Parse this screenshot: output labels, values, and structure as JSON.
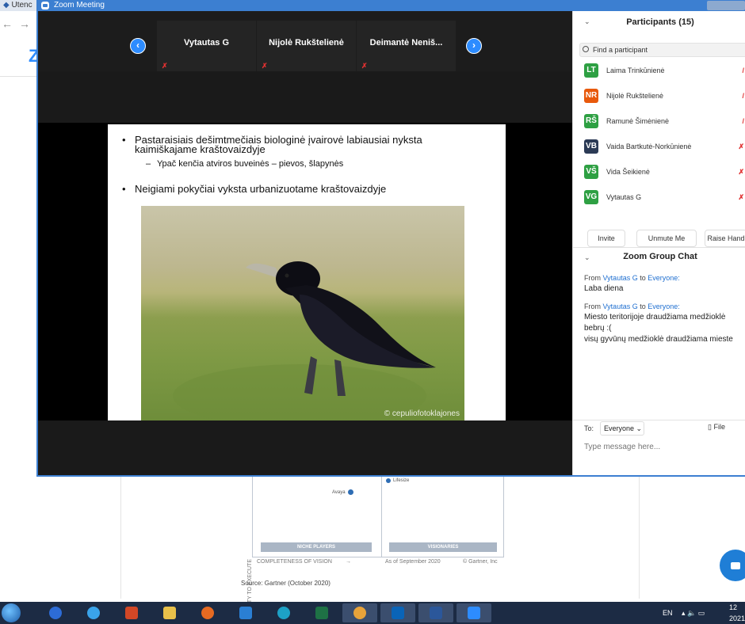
{
  "browser": {
    "tab_label": "Utenc",
    "back_symbol": "←",
    "forward_symbol": "→",
    "logo_letter": "Z"
  },
  "document": {
    "y_axis_label": "ABILITY TO EXECUTE",
    "x_axis_label": "COMPLETENESS OF VISION",
    "arrow": "→",
    "date_label": "As of September 2020",
    "copyright": "© Gartner, Inc",
    "quadrant_left": "NICHE PLAYERS",
    "quadrant_right": "VISIONARIES",
    "vendor_1": "Avaya",
    "vendor_2": "Lifesize",
    "source": "Source: Gartner (October 2020)"
  },
  "zoom": {
    "window_title": "Zoom Meeting",
    "prev_arrow": "‹",
    "next_arrow": "›",
    "thumbnails": [
      {
        "name": "Vytautas G"
      },
      {
        "name": "Nijolė Rukštelienė"
      },
      {
        "name": "Deimantė  Neniš..."
      }
    ],
    "slide": {
      "bullet1": "Pastaraisiais dešimtmečiais biologinė įvairovė labiausiai nyksta kaimiškajame kraštovaizdyje",
      "sub1": "Ypač kenčia atviros buveinės – pievos, šlapynės",
      "bullet2": "Neigiami pokyčiai vyksta urbanizuotame kraštovaizdyje",
      "photo_credit": "© cepuliofotoklajones"
    }
  },
  "participants": {
    "title": "Participants (15)",
    "collapse": "⌄",
    "search_placeholder": "Find a participant",
    "list": [
      {
        "initials": "LT",
        "name": "Laima Trinkūnienė",
        "color": "#2ea043"
      },
      {
        "initials": "NR",
        "name": "Nijolė Rukštelienė",
        "color": "#e8590c"
      },
      {
        "initials": "RŠ",
        "name": "Ramunė Šimėnienė",
        "color": "#2ea043"
      },
      {
        "initials": "VB",
        "name": "Vaida Bartkutė-Norkūnienė",
        "color": "#2b3a55"
      },
      {
        "initials": "VŠ",
        "name": "Vida Šeikienė",
        "color": "#2ea043"
      },
      {
        "initials": "VG",
        "name": "Vytautas G",
        "color": "#2ea043"
      }
    ],
    "invite_label": "Invite",
    "unmute_label": "Unmute Me",
    "raise_hand_label": "Raise Hand"
  },
  "chat": {
    "title": "Zoom Group Chat",
    "collapse": "⌄",
    "messages": [
      {
        "from_prefix": "From",
        "sender": "Vytautas G",
        "to_word": "to",
        "recipient": "Everyone:",
        "lines": [
          "Laba diena"
        ]
      },
      {
        "from_prefix": "From",
        "sender": "Vytautas G",
        "to_word": "to",
        "recipient": "Everyone:",
        "lines": [
          "Miesto teritorijoje draudžiama medžioklė",
          "bebrų :(",
          "visų gyvūnų medžioklė draudžiama mieste"
        ]
      }
    ],
    "to_label": "To:",
    "to_value": "Everyone",
    "file_label": "File",
    "input_placeholder": "Type message here..."
  },
  "taskbar": {
    "language": "EN",
    "tray_symbols": "▴ 🔈 ▭",
    "clock_time": "12",
    "clock_date": "2021"
  }
}
